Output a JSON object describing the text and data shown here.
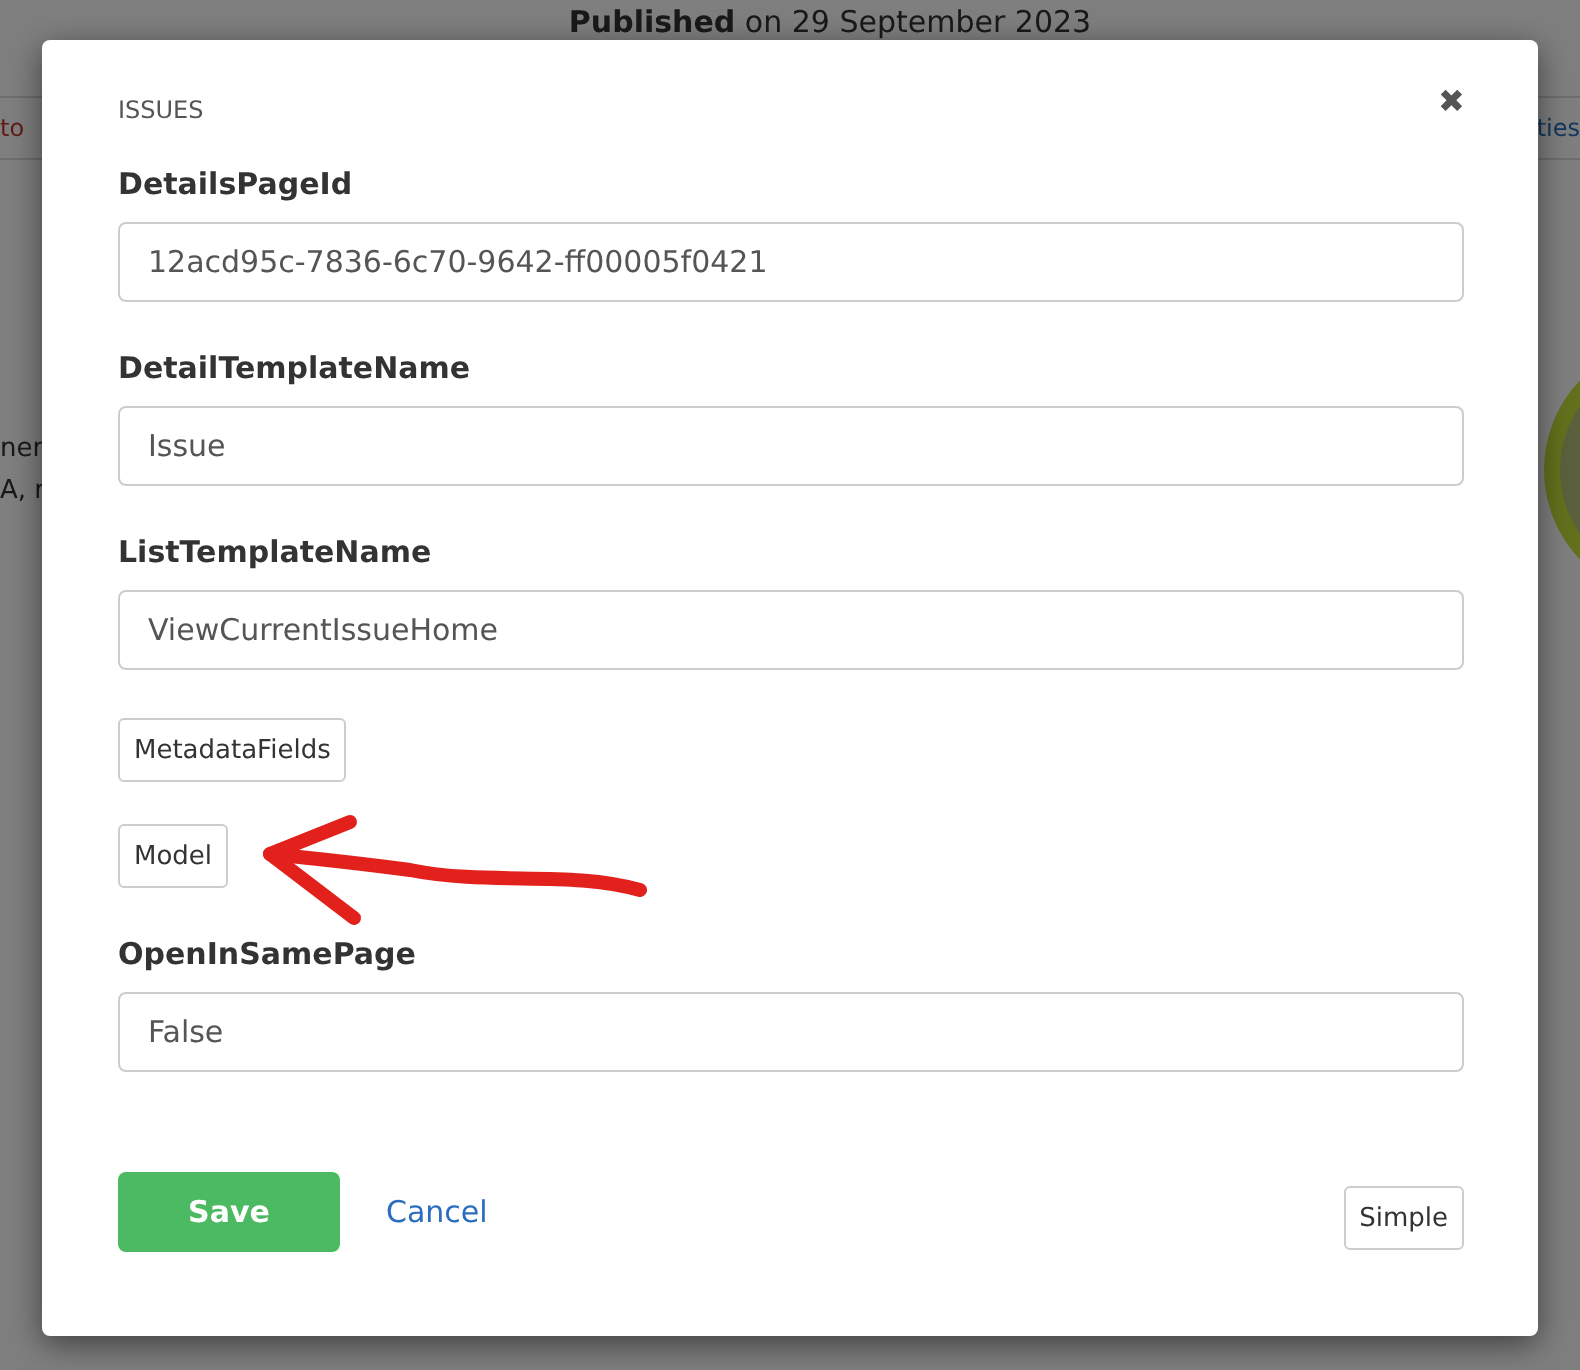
{
  "background": {
    "header": "**Published** on 29 September 2023",
    "left_link": "to",
    "right_link": "ties",
    "left_lines": [
      "ner",
      "A, r"
    ]
  },
  "modal": {
    "title": "ISSUES",
    "close": "✖",
    "fields": [
      {
        "kind": "input",
        "label": "DetailsPageId",
        "value": "12acd95c-7836-6c70-9642-ff00005f0421"
      },
      {
        "kind": "input",
        "label": "DetailTemplateName",
        "value": "Issue"
      },
      {
        "kind": "input",
        "label": "ListTemplateName",
        "value": "ViewCurrentIssueHome"
      },
      {
        "kind": "button",
        "label": "MetadataFields"
      },
      {
        "kind": "button",
        "label": "Model"
      },
      {
        "kind": "input",
        "label": "OpenInSamePage",
        "value": "False"
      }
    ],
    "actions": {
      "save": "Save",
      "cancel": "Cancel",
      "mode": "Simple"
    }
  }
}
